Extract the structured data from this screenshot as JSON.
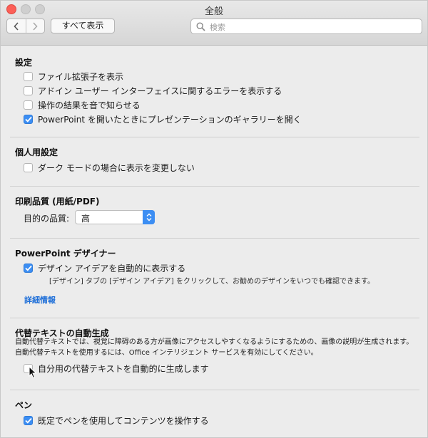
{
  "window": {
    "title": "全般"
  },
  "toolbar": {
    "back_label": "‹",
    "forward_label": "›",
    "show_all_label": "すべて表示",
    "search_placeholder": "検索"
  },
  "sections": {
    "settings": {
      "title": "設定",
      "items": [
        {
          "label": "ファイル拡張子を表示",
          "checked": false
        },
        {
          "label": "アドイン ユーザー インターフェイスに関するエラーを表示する",
          "checked": false
        },
        {
          "label": "操作の結果を音で知らせる",
          "checked": false
        },
        {
          "label": "PowerPoint を開いたときにプレゼンテーションのギャラリーを開く",
          "checked": true
        }
      ]
    },
    "personal": {
      "title": "個人用設定",
      "items": [
        {
          "label": "ダーク モードの場合に表示を変更しない",
          "checked": false
        }
      ]
    },
    "print_quality": {
      "title": "印刷品質 (用紙/PDF)",
      "target_label": "目的の品質:",
      "target_value": "高"
    },
    "designer": {
      "title": "PowerPoint デザイナー",
      "item": {
        "label": "デザイン アイデアを自動的に表示する",
        "checked": true
      },
      "sublabel": "[デザイン] タブの [デザイン アイデア] をクリックして、お勧めのデザインをいつでも確認できます。",
      "link": "詳細情報"
    },
    "alt_text": {
      "title": "代替テキストの自動生成",
      "description_line1": "自動代替テキストでは、視覚に障碍のある方が画像にアクセスしやすくなるようにするための、画像の説明が生成されます。自動代替テキストを使用するには、Office インテリジェント サービスを有効にしてください。",
      "item": {
        "label": "自分用の代替テキストを自動的に生成します",
        "checked": false
      }
    },
    "pen": {
      "title": "ペン",
      "item": {
        "label": "既定でペンを使用してコンテンツを操作する",
        "checked": true
      }
    }
  },
  "colors": {
    "accent": "#3c8ef3",
    "link": "#1d6ed8"
  }
}
